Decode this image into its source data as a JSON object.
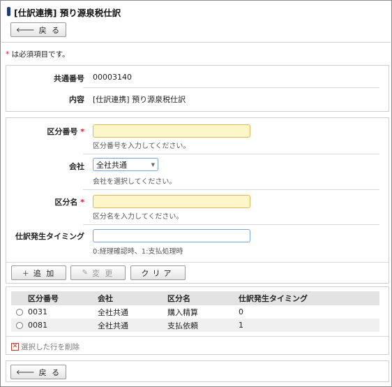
{
  "header": {
    "title": "[仕訳連携] 預り源泉税仕訳"
  },
  "buttons": {
    "back_top": "戻 る",
    "back_bottom": "戻 る",
    "add": "追 加",
    "edit": "変 更",
    "clear": "クリア"
  },
  "required_note": {
    "star": "*",
    "text": " は必須項目です。"
  },
  "info": {
    "common_no_label": "共通番号",
    "common_no_value": "00003140",
    "content_label": "内容",
    "content_value": "[仕訳連携] 預り源泉税仕訳"
  },
  "form": {
    "code_label": "区分番号",
    "code_value": "",
    "code_hint": "区分番号を入力してください。",
    "company_label": "会社",
    "company_selected": "全社共通",
    "company_hint": "会社を選択してください。",
    "name_label": "区分名",
    "name_value": "",
    "name_hint": "区分名を入力してください。",
    "timing_label": "仕訳発生タイミング",
    "timing_value": "",
    "timing_hint": "0:経理確認時、1:支払処理時",
    "required_mark": "*"
  },
  "table": {
    "headers": [
      "区分番号",
      "会社",
      "区分名",
      "仕訳発生タイミング"
    ],
    "rows": [
      {
        "code": "0031",
        "company": "全社共通",
        "name": "購入精算",
        "timing": "0"
      },
      {
        "code": "0081",
        "company": "全社共通",
        "name": "支払依頼",
        "timing": "1"
      }
    ]
  },
  "delete_selected": "選択した行を削除",
  "icons": {
    "back": "arrow-left-icon",
    "add": "plus-icon",
    "edit": "pencil-icon",
    "delete": "x-box-icon"
  },
  "colors": {
    "required_star": "#d9142b",
    "required_field_bg": "#fdf6c8",
    "title_marker": "#1f3c7a"
  }
}
